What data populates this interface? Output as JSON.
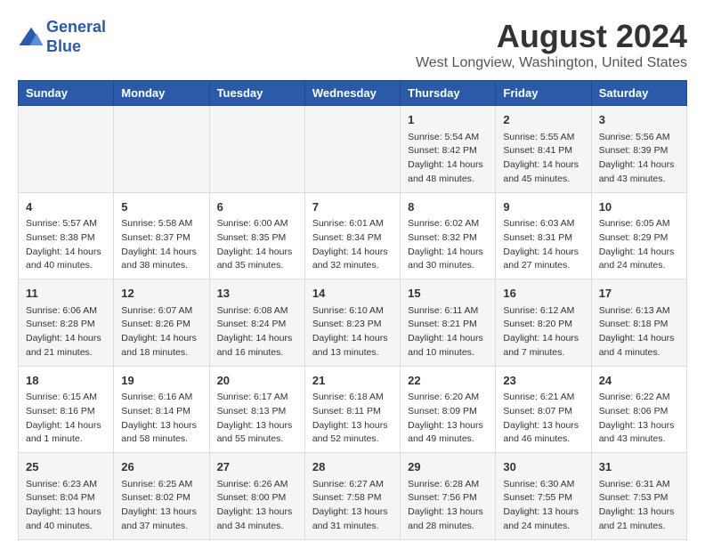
{
  "header": {
    "logo_line1": "General",
    "logo_line2": "Blue",
    "main_title": "August 2024",
    "subtitle": "West Longview, Washington, United States"
  },
  "days_of_week": [
    "Sunday",
    "Monday",
    "Tuesday",
    "Wednesday",
    "Thursday",
    "Friday",
    "Saturday"
  ],
  "weeks": [
    [
      {
        "day": "",
        "content": ""
      },
      {
        "day": "",
        "content": ""
      },
      {
        "day": "",
        "content": ""
      },
      {
        "day": "",
        "content": ""
      },
      {
        "day": "1",
        "content": "Sunrise: 5:54 AM\nSunset: 8:42 PM\nDaylight: 14 hours\nand 48 minutes."
      },
      {
        "day": "2",
        "content": "Sunrise: 5:55 AM\nSunset: 8:41 PM\nDaylight: 14 hours\nand 45 minutes."
      },
      {
        "day": "3",
        "content": "Sunrise: 5:56 AM\nSunset: 8:39 PM\nDaylight: 14 hours\nand 43 minutes."
      }
    ],
    [
      {
        "day": "4",
        "content": "Sunrise: 5:57 AM\nSunset: 8:38 PM\nDaylight: 14 hours\nand 40 minutes."
      },
      {
        "day": "5",
        "content": "Sunrise: 5:58 AM\nSunset: 8:37 PM\nDaylight: 14 hours\nand 38 minutes."
      },
      {
        "day": "6",
        "content": "Sunrise: 6:00 AM\nSunset: 8:35 PM\nDaylight: 14 hours\nand 35 minutes."
      },
      {
        "day": "7",
        "content": "Sunrise: 6:01 AM\nSunset: 8:34 PM\nDaylight: 14 hours\nand 32 minutes."
      },
      {
        "day": "8",
        "content": "Sunrise: 6:02 AM\nSunset: 8:32 PM\nDaylight: 14 hours\nand 30 minutes."
      },
      {
        "day": "9",
        "content": "Sunrise: 6:03 AM\nSunset: 8:31 PM\nDaylight: 14 hours\nand 27 minutes."
      },
      {
        "day": "10",
        "content": "Sunrise: 6:05 AM\nSunset: 8:29 PM\nDaylight: 14 hours\nand 24 minutes."
      }
    ],
    [
      {
        "day": "11",
        "content": "Sunrise: 6:06 AM\nSunset: 8:28 PM\nDaylight: 14 hours\nand 21 minutes."
      },
      {
        "day": "12",
        "content": "Sunrise: 6:07 AM\nSunset: 8:26 PM\nDaylight: 14 hours\nand 18 minutes."
      },
      {
        "day": "13",
        "content": "Sunrise: 6:08 AM\nSunset: 8:24 PM\nDaylight: 14 hours\nand 16 minutes."
      },
      {
        "day": "14",
        "content": "Sunrise: 6:10 AM\nSunset: 8:23 PM\nDaylight: 14 hours\nand 13 minutes."
      },
      {
        "day": "15",
        "content": "Sunrise: 6:11 AM\nSunset: 8:21 PM\nDaylight: 14 hours\nand 10 minutes."
      },
      {
        "day": "16",
        "content": "Sunrise: 6:12 AM\nSunset: 8:20 PM\nDaylight: 14 hours\nand 7 minutes."
      },
      {
        "day": "17",
        "content": "Sunrise: 6:13 AM\nSunset: 8:18 PM\nDaylight: 14 hours\nand 4 minutes."
      }
    ],
    [
      {
        "day": "18",
        "content": "Sunrise: 6:15 AM\nSunset: 8:16 PM\nDaylight: 14 hours\nand 1 minute."
      },
      {
        "day": "19",
        "content": "Sunrise: 6:16 AM\nSunset: 8:14 PM\nDaylight: 13 hours\nand 58 minutes."
      },
      {
        "day": "20",
        "content": "Sunrise: 6:17 AM\nSunset: 8:13 PM\nDaylight: 13 hours\nand 55 minutes."
      },
      {
        "day": "21",
        "content": "Sunrise: 6:18 AM\nSunset: 8:11 PM\nDaylight: 13 hours\nand 52 minutes."
      },
      {
        "day": "22",
        "content": "Sunrise: 6:20 AM\nSunset: 8:09 PM\nDaylight: 13 hours\nand 49 minutes."
      },
      {
        "day": "23",
        "content": "Sunrise: 6:21 AM\nSunset: 8:07 PM\nDaylight: 13 hours\nand 46 minutes."
      },
      {
        "day": "24",
        "content": "Sunrise: 6:22 AM\nSunset: 8:06 PM\nDaylight: 13 hours\nand 43 minutes."
      }
    ],
    [
      {
        "day": "25",
        "content": "Sunrise: 6:23 AM\nSunset: 8:04 PM\nDaylight: 13 hours\nand 40 minutes."
      },
      {
        "day": "26",
        "content": "Sunrise: 6:25 AM\nSunset: 8:02 PM\nDaylight: 13 hours\nand 37 minutes."
      },
      {
        "day": "27",
        "content": "Sunrise: 6:26 AM\nSunset: 8:00 PM\nDaylight: 13 hours\nand 34 minutes."
      },
      {
        "day": "28",
        "content": "Sunrise: 6:27 AM\nSunset: 7:58 PM\nDaylight: 13 hours\nand 31 minutes."
      },
      {
        "day": "29",
        "content": "Sunrise: 6:28 AM\nSunset: 7:56 PM\nDaylight: 13 hours\nand 28 minutes."
      },
      {
        "day": "30",
        "content": "Sunrise: 6:30 AM\nSunset: 7:55 PM\nDaylight: 13 hours\nand 24 minutes."
      },
      {
        "day": "31",
        "content": "Sunrise: 6:31 AM\nSunset: 7:53 PM\nDaylight: 13 hours\nand 21 minutes."
      }
    ]
  ]
}
